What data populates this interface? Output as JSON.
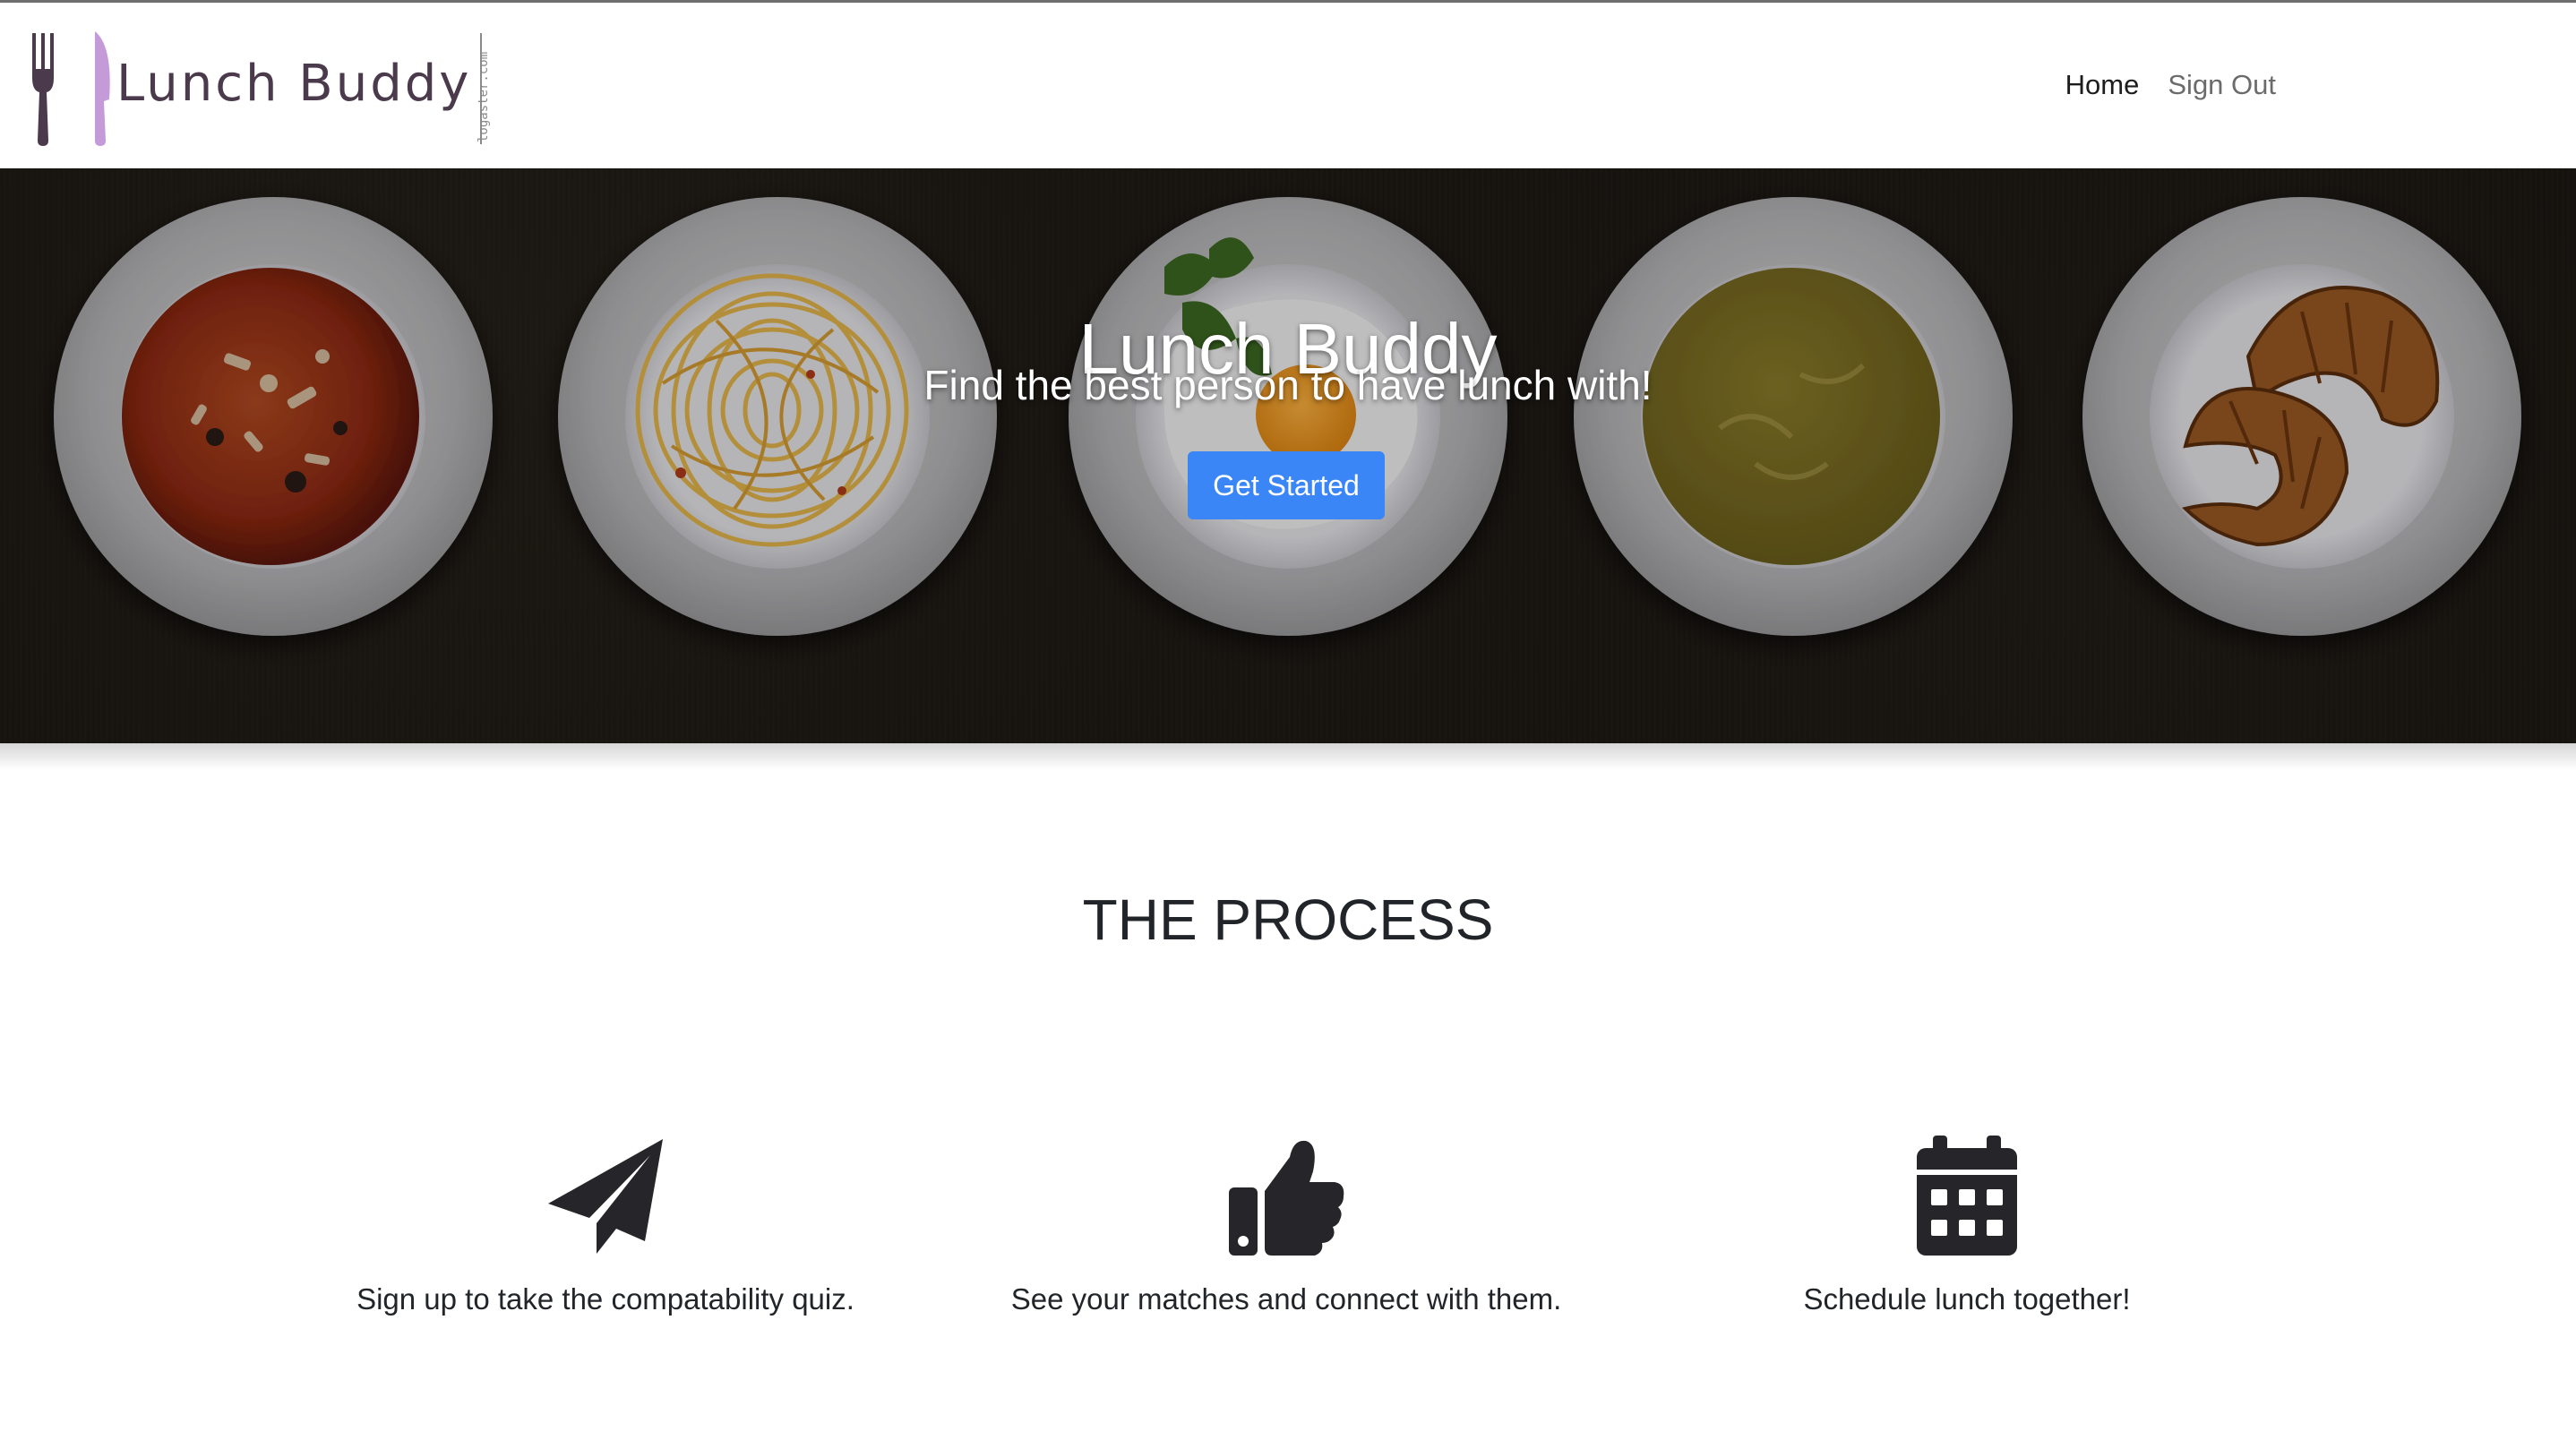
{
  "navbar": {
    "brand_name": "Lunch Buddy",
    "brand_side_text": "logaster.com",
    "links": [
      {
        "label": "Home",
        "active": true
      },
      {
        "label": "Sign Out",
        "active": false
      }
    ]
  },
  "hero": {
    "title": "Lunch Buddy",
    "subtitle": "Find the best person to have lunch with!",
    "cta_label": "Get Started",
    "plates": [
      "soup-minestrone",
      "spaghetti",
      "fried-egg",
      "pea-soup",
      "croissants"
    ]
  },
  "process": {
    "title": "THE PROCESS",
    "steps": [
      {
        "icon": "paper-plane-icon",
        "text": "Sign up to take the compatability quiz."
      },
      {
        "icon": "thumbs-up-icon",
        "text": "See your matches and connect with them."
      },
      {
        "icon": "calendar-icon",
        "text": "Schedule lunch together!"
      }
    ]
  },
  "colors": {
    "primary_button": "#3b86f7",
    "hero_background": "#181510",
    "brand_text": "#4b3a4b",
    "brand_fork": "#4b3a4b",
    "brand_knife": "#c59ad9"
  }
}
